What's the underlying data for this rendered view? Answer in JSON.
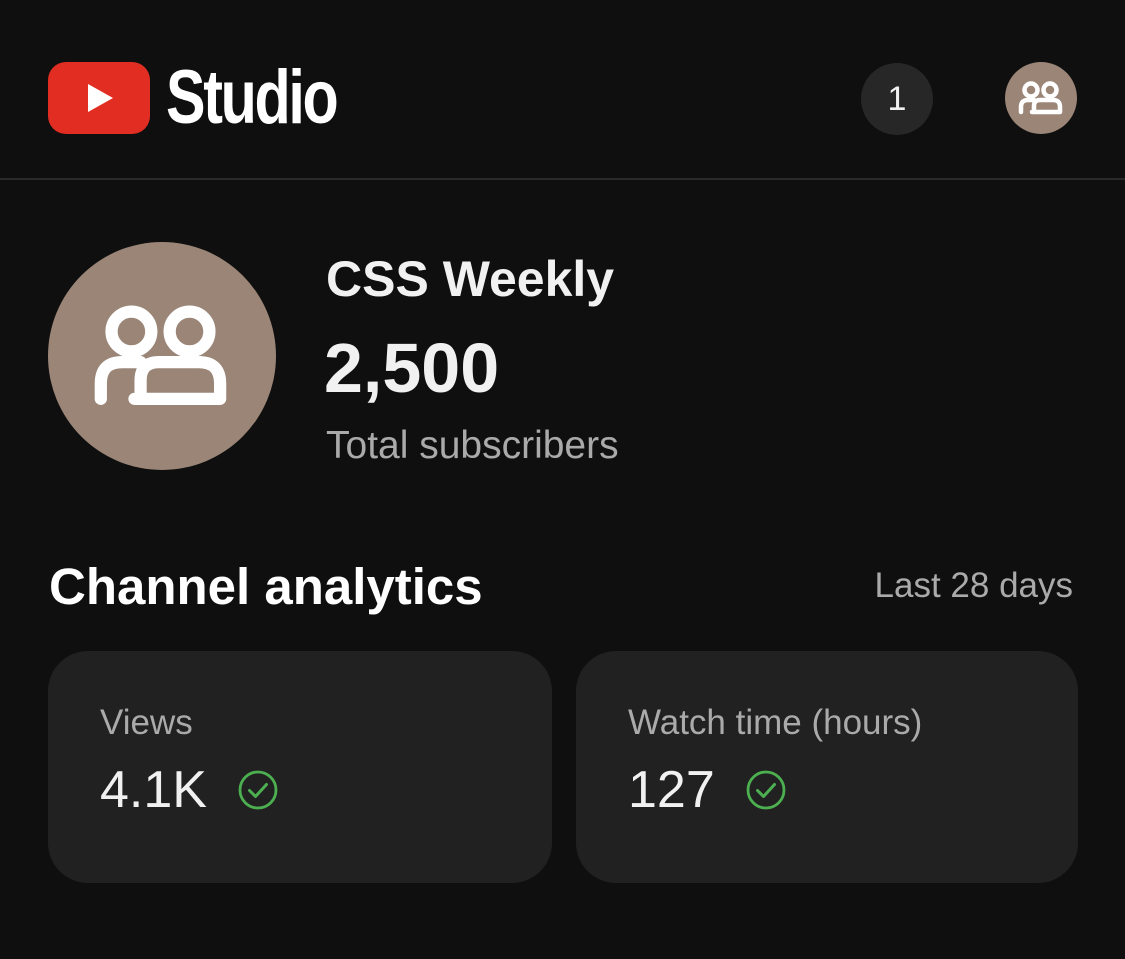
{
  "header": {
    "app_title": "Studio",
    "notifications_count": "1",
    "icons": {
      "logo": "play-icon",
      "account": "people-icon"
    }
  },
  "channel": {
    "name": "CSS Weekly",
    "subscriber_count": "2,500",
    "subscriber_label": "Total subscribers",
    "avatar_icon": "people-icon"
  },
  "analytics": {
    "title": "Channel analytics",
    "period": "Last 28 days",
    "cards": [
      {
        "label": "Views",
        "value": "4.1K",
        "status_icon": "check-circle-icon"
      },
      {
        "label": "Watch time (hours)",
        "value": "127",
        "status_icon": "check-circle-icon"
      }
    ]
  },
  "colors": {
    "background": "#0f0f0f",
    "card": "#212121",
    "brand_red": "#e22d22",
    "avatar": "#9a8577",
    "success": "#4caf50",
    "secondary_text": "#aaaaaa"
  }
}
